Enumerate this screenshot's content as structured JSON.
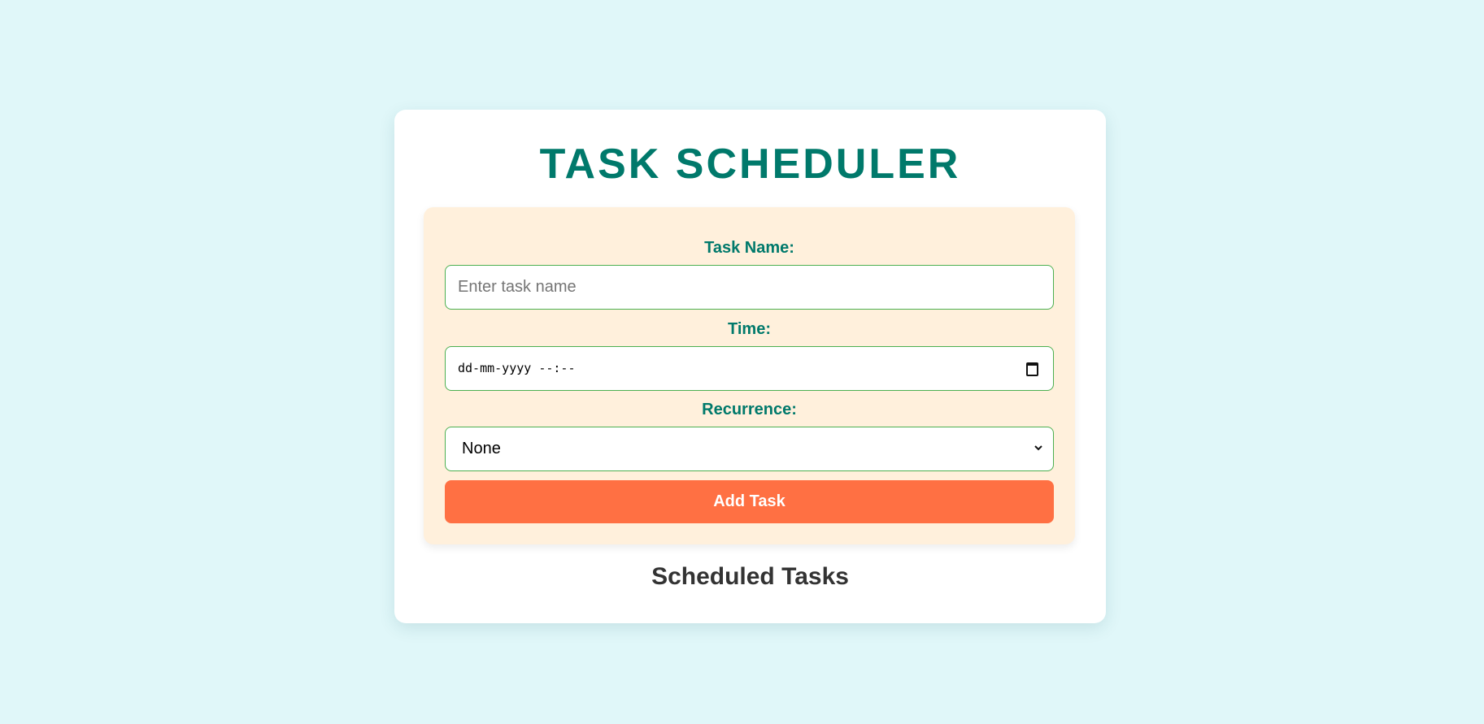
{
  "app": {
    "title": "TASK SCHEDULER"
  },
  "form": {
    "task_name_label": "Task Name:",
    "task_name_placeholder": "Enter task name",
    "time_label": "Time:",
    "time_placeholder": "dd-mm-yyyy --:--",
    "time_icon": "calendar-icon",
    "recurrence_label": "Recurrence:",
    "recurrence_value": "None",
    "recurrence_icon": "chevron-down-icon",
    "add_button_label": "Add Task"
  },
  "tasks": {
    "heading": "Scheduled Tasks",
    "items": []
  },
  "colors": {
    "background": "#e0f7f9",
    "accent": "#00796b",
    "panel": "#fff0dc",
    "button": "#ff7043",
    "field_border": "#4caf50"
  }
}
